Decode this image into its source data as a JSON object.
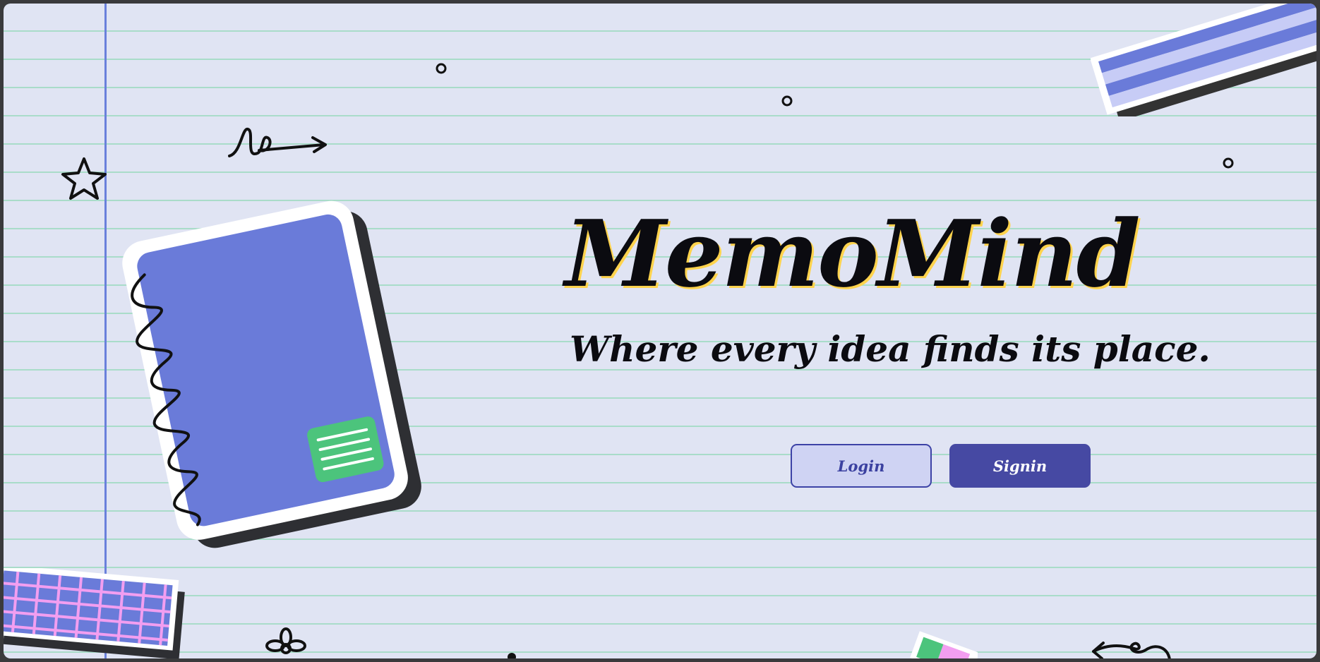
{
  "app": {
    "title": "MemoMind",
    "tagline": "Where every idea finds its place."
  },
  "actions": {
    "login_label": "Login",
    "signin_label": "Signin"
  },
  "colors": {
    "background": "#e0e4f3",
    "ruled_line": "#a9dcc9",
    "margin_line": "#6a80db",
    "notebook": "#6a7bd9",
    "label_green": "#4cc47c",
    "login_fill": "#cfd3f3",
    "signin_fill": "#4649a3"
  },
  "decorations": {
    "icons": [
      "star-icon",
      "loop-arrow-icon",
      "notebook-icon",
      "washi-tape-icon",
      "grid-tape-icon",
      "flower-icon",
      "curl-arrow-icon",
      "small-circle-icon"
    ]
  }
}
